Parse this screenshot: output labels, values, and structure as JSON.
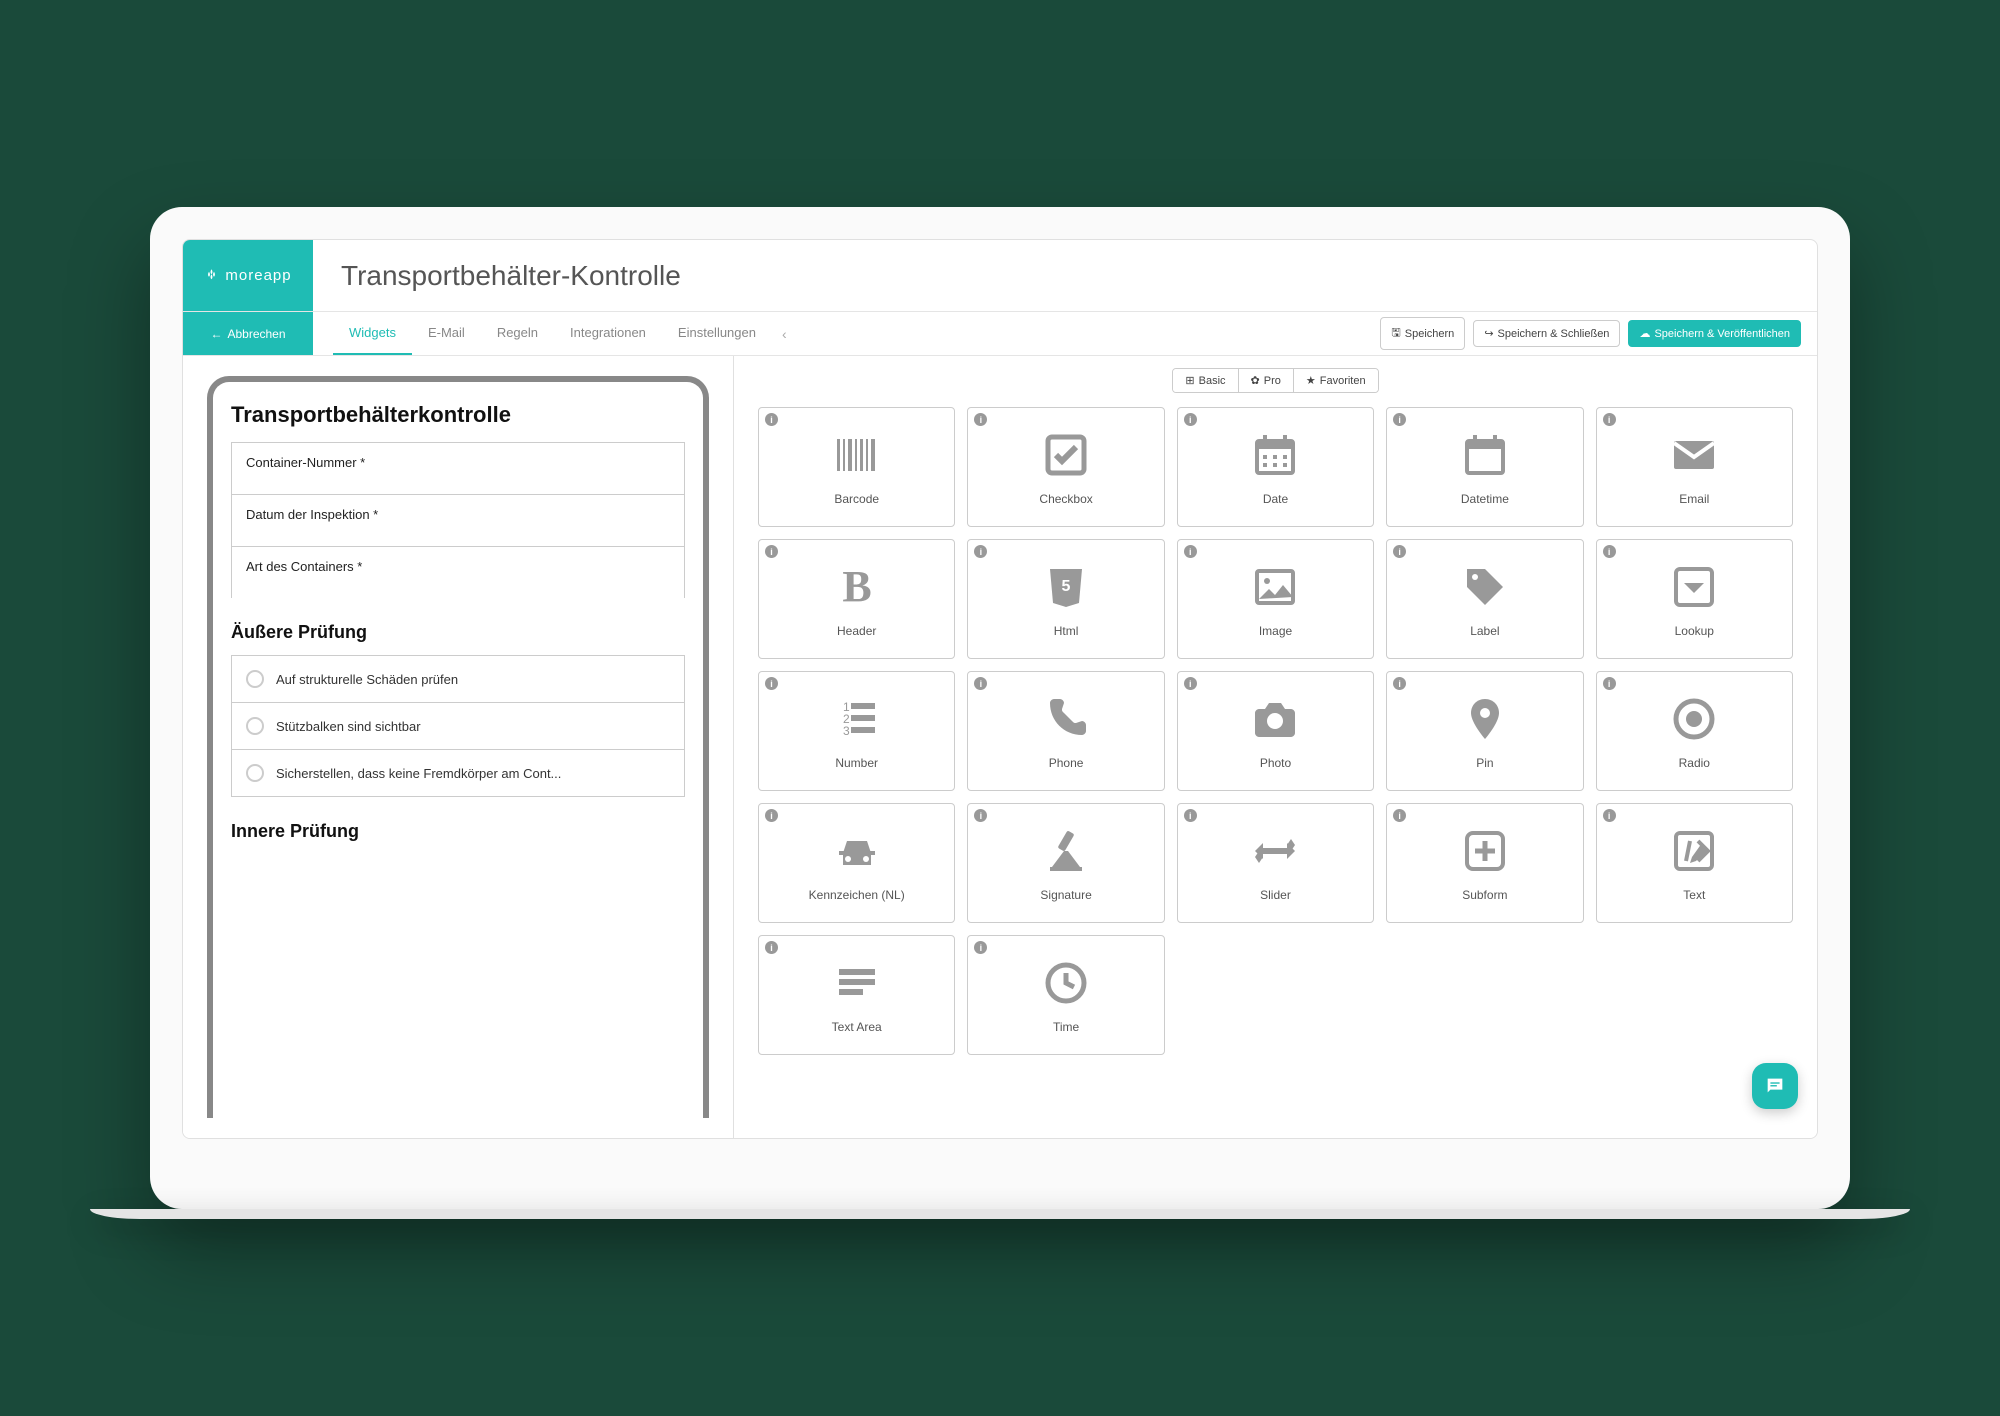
{
  "brand": "moreapp",
  "page_title": "Transportbehälter-Kontrolle",
  "cancel_label": "Abbrechen",
  "tabs": [
    "Widgets",
    "E-Mail",
    "Regeln",
    "Integrationen",
    "Einstellungen"
  ],
  "active_tab_index": 0,
  "actions": {
    "save": "Speichern",
    "save_close": "Speichern & Schließen",
    "save_publish": "Speichern & Veröffentlichen"
  },
  "preview": {
    "form_title": "Transportbehälterkontrolle",
    "fields": [
      "Container-Nummer *",
      "Datum der Inspektion *",
      "Art des Containers *"
    ],
    "section1_title": "Äußere Prüfung",
    "section1_items": [
      "Auf strukturelle Schäden prüfen",
      "Stützbalken sind sichtbar",
      "Sicherstellen, dass keine Fremdkörper am Cont..."
    ],
    "section2_title": "Innere Prüfung"
  },
  "filters": {
    "basic": "Basic",
    "pro": "Pro",
    "favorites": "Favoriten"
  },
  "widgets": [
    {
      "id": "barcode",
      "label": "Barcode"
    },
    {
      "id": "checkbox",
      "label": "Checkbox"
    },
    {
      "id": "date",
      "label": "Date"
    },
    {
      "id": "datetime",
      "label": "Datetime"
    },
    {
      "id": "email",
      "label": "Email"
    },
    {
      "id": "header",
      "label": "Header"
    },
    {
      "id": "html",
      "label": "Html"
    },
    {
      "id": "image",
      "label": "Image"
    },
    {
      "id": "label",
      "label": "Label"
    },
    {
      "id": "lookup",
      "label": "Lookup"
    },
    {
      "id": "number",
      "label": "Number"
    },
    {
      "id": "phone",
      "label": "Phone"
    },
    {
      "id": "photo",
      "label": "Photo"
    },
    {
      "id": "pin",
      "label": "Pin"
    },
    {
      "id": "radio",
      "label": "Radio"
    },
    {
      "id": "license",
      "label": "Kennzeichen (NL)"
    },
    {
      "id": "signature",
      "label": "Signature"
    },
    {
      "id": "slider",
      "label": "Slider"
    },
    {
      "id": "subform",
      "label": "Subform"
    },
    {
      "id": "text",
      "label": "Text"
    },
    {
      "id": "textarea",
      "label": "Text Area"
    },
    {
      "id": "time",
      "label": "Time"
    }
  ]
}
